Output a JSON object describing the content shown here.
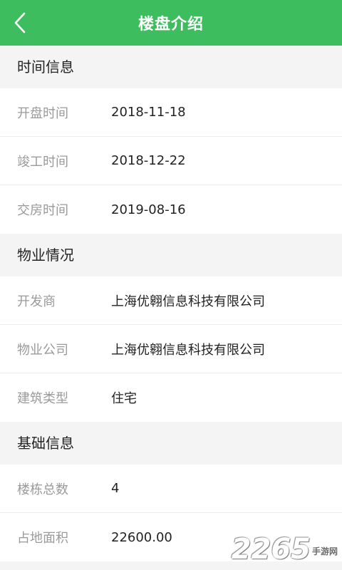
{
  "header": {
    "title": "楼盘介绍",
    "back_icon": "chevron-left-icon"
  },
  "sections": [
    {
      "title": "时间信息",
      "rows": [
        {
          "label": "开盘时间",
          "value": "2018-11-18"
        },
        {
          "label": "竣工时间",
          "value": "2018-12-22"
        },
        {
          "label": "交房时间",
          "value": "2019-08-16"
        }
      ]
    },
    {
      "title": "物业情况",
      "rows": [
        {
          "label": "开发商",
          "value": "上海优翱信息科技有限公司"
        },
        {
          "label": "物业公司",
          "value": "上海优翱信息科技有限公司"
        },
        {
          "label": "建筑类型",
          "value": "住宅"
        }
      ]
    },
    {
      "title": "基础信息",
      "rows": [
        {
          "label": "楼栋总数",
          "value": "4"
        },
        {
          "label": "占地面积",
          "value": "22600.00"
        }
      ]
    }
  ],
  "watermark": {
    "number": "2265",
    "sub": "手游网"
  },
  "colors": {
    "header_bg": "#3dbd5d",
    "label": "#9a9a9a",
    "value": "#222222"
  }
}
